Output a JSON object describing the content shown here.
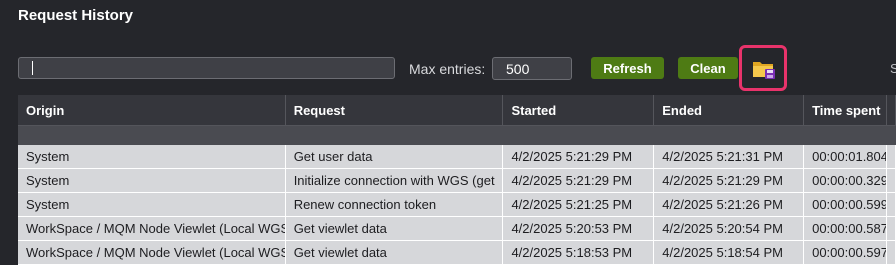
{
  "window": {
    "title": "Request History"
  },
  "toolbar": {
    "search_value": "",
    "max_entries_label": "Max entries:",
    "max_entries_value": "500",
    "refresh_label": "Refresh",
    "clean_label": "Clean",
    "edge_text": "S",
    "accent": "#4e7b14",
    "highlight_color": "#e8336b"
  },
  "table": {
    "columns": [
      "Origin",
      "Request",
      "Started",
      "Ended",
      "Time spent",
      ""
    ],
    "rows": [
      {
        "origin": "System",
        "request": "Get user data",
        "started": "4/2/2025 5:21:29 PM",
        "ended": "4/2/2025 5:21:31 PM",
        "time": "00:00:01.804"
      },
      {
        "origin": "System",
        "request": "Initialize connection with WGS (get",
        "started": "4/2/2025 5:21:29 PM",
        "ended": "4/2/2025 5:21:29 PM",
        "time": "00:00:00.329"
      },
      {
        "origin": "System",
        "request": "Renew connection token",
        "started": "4/2/2025 5:21:25 PM",
        "ended": "4/2/2025 5:21:26 PM",
        "time": "00:00:00.599"
      },
      {
        "origin": "WorkSpace / MQM Node Viewlet (Local WGS",
        "request": "Get viewlet data",
        "started": "4/2/2025 5:20:53 PM",
        "ended": "4/2/2025 5:20:54 PM",
        "time": "00:00:00.587"
      },
      {
        "origin": "WorkSpace / MQM Node Viewlet (Local WGS",
        "request": "Get viewlet data",
        "started": "4/2/2025 5:18:53 PM",
        "ended": "4/2/2025 5:18:54 PM",
        "time": "00:00:00.597"
      }
    ]
  }
}
